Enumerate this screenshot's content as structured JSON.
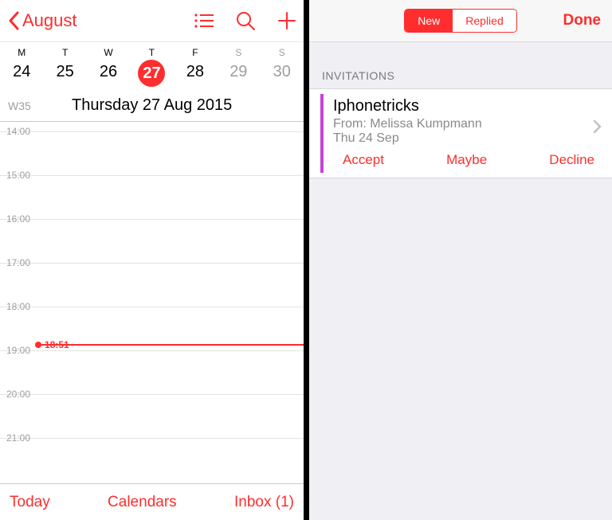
{
  "left": {
    "back_label": "August",
    "week_days": [
      {
        "abbr": "M",
        "num": "24",
        "dim": false,
        "selected": false
      },
      {
        "abbr": "T",
        "num": "25",
        "dim": false,
        "selected": false
      },
      {
        "abbr": "W",
        "num": "26",
        "dim": false,
        "selected": false
      },
      {
        "abbr": "T",
        "num": "27",
        "dim": false,
        "selected": true
      },
      {
        "abbr": "F",
        "num": "28",
        "dim": false,
        "selected": false
      },
      {
        "abbr": "S",
        "num": "29",
        "dim": true,
        "selected": false
      },
      {
        "abbr": "S",
        "num": "30",
        "dim": true,
        "selected": false
      }
    ],
    "week_number": "W35",
    "full_date": "Thursday  27 Aug 2015",
    "hours": [
      "14:00",
      "15:00",
      "16:00",
      "17:00",
      "18:00",
      "19:00",
      "20:00",
      "21:00"
    ],
    "now_time": "18:51",
    "footer": {
      "today": "Today",
      "calendars": "Calendars",
      "inbox": "Inbox (1)"
    }
  },
  "right": {
    "seg_new": "New",
    "seg_replied": "Replied",
    "done": "Done",
    "section": "INVITATIONS",
    "invite": {
      "title": "Iphonetricks",
      "from": "From: Melissa Kumpmann",
      "date": "Thu 24 Sep",
      "accept": "Accept",
      "maybe": "Maybe",
      "decline": "Decline"
    }
  }
}
